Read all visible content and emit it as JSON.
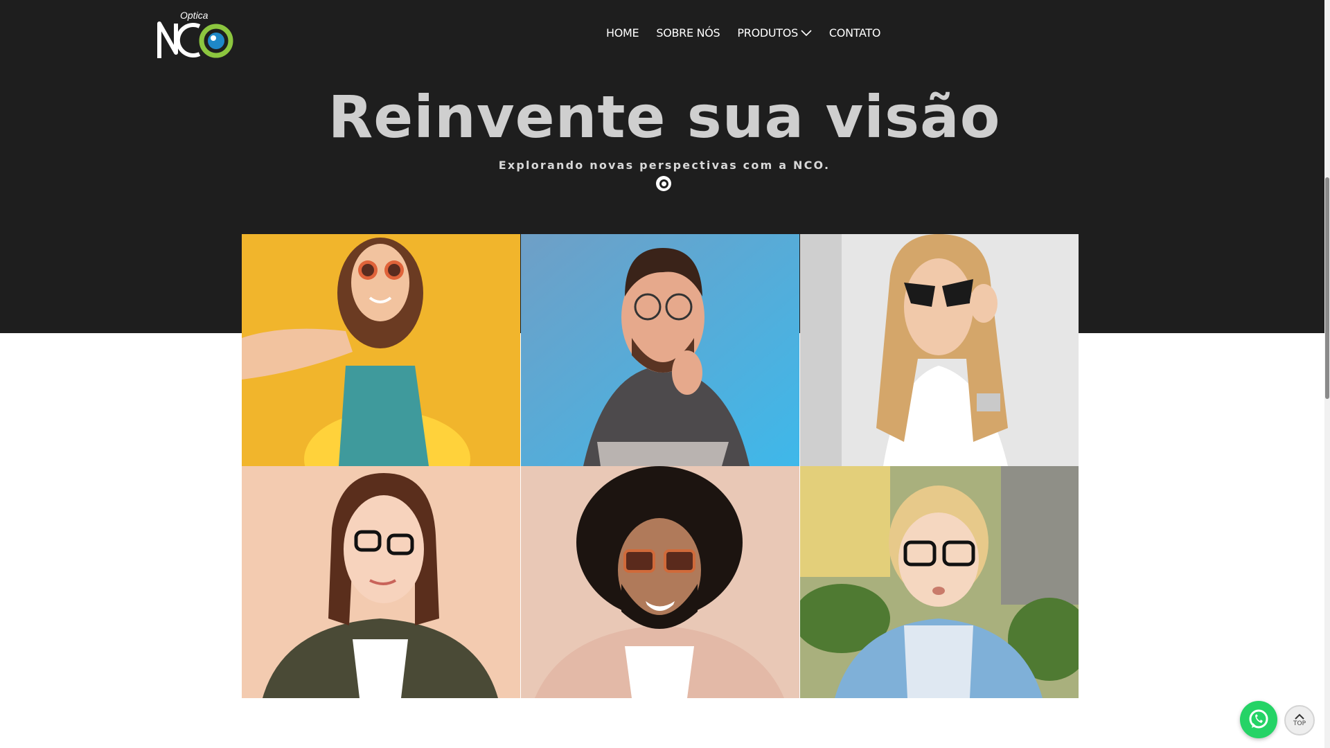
{
  "brand": {
    "subtitle": "Optica",
    "wordmark": "NCO",
    "accent": "#8cc63f",
    "eye": "#1e88c8"
  },
  "nav": {
    "items": [
      {
        "label": "HOME"
      },
      {
        "label": "SOBRE NÓS"
      },
      {
        "label": "PRODUTOS",
        "has_dropdown": true
      },
      {
        "label": "CONTATO"
      }
    ]
  },
  "hero": {
    "title": "Reinvente sua visão",
    "subtitle": "Explorando novas perspectivas com a NCO."
  },
  "gallery": {
    "photos": [
      {
        "subject": "girl with orange round sunglasses",
        "background": "#f1b52c"
      },
      {
        "subject": "man with clear glasses",
        "background": "#5aa9d8"
      },
      {
        "subject": "woman with black cat-eye sunglasses",
        "background": "#e3e3e3"
      },
      {
        "subject": "woman with black glasses",
        "background": "#f3cbb0"
      },
      {
        "subject": "man with orange sunglasses",
        "background": "#e9c8b6"
      },
      {
        "subject": "boy with black glasses",
        "background": "#9aa36a"
      }
    ]
  },
  "floating": {
    "top_label": "TOP",
    "whatsapp_color": "#25d366"
  }
}
